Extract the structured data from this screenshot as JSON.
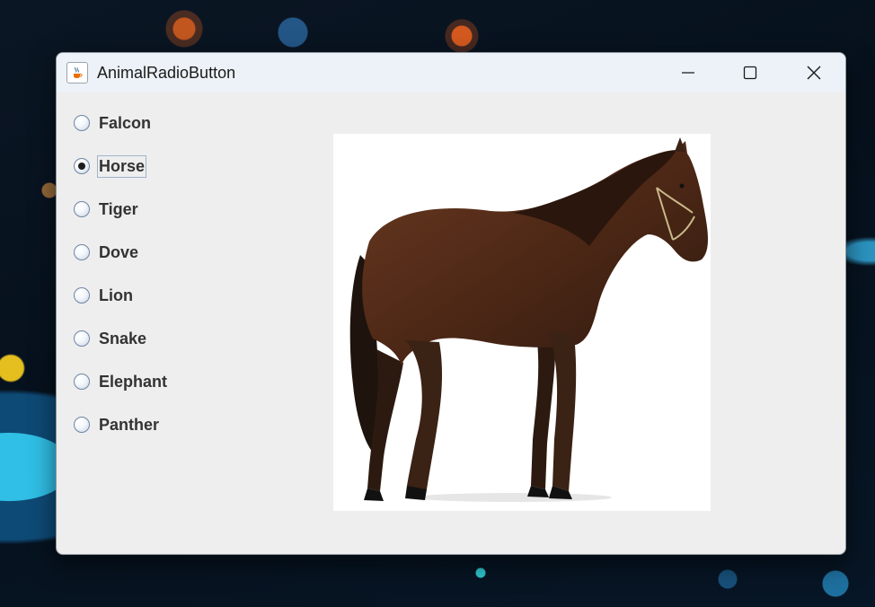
{
  "window": {
    "title": "AnimalRadioButton"
  },
  "radio_group": {
    "options": [
      {
        "label": "Falcon",
        "selected": false
      },
      {
        "label": "Horse",
        "selected": true
      },
      {
        "label": "Tiger",
        "selected": false
      },
      {
        "label": "Dove",
        "selected": false
      },
      {
        "label": "Lion",
        "selected": false
      },
      {
        "label": "Snake",
        "selected": false
      },
      {
        "label": "Elephant",
        "selected": false
      },
      {
        "label": "Panther",
        "selected": false
      }
    ]
  },
  "image": {
    "subject": "horse"
  },
  "icons": {
    "app": "java-coffee-cup-icon",
    "minimize": "minimize-icon",
    "maximize": "maximize-icon",
    "close": "close-icon"
  },
  "colors": {
    "window_bg": "#eeeeee",
    "titlebar_bg": "#ecf2f7",
    "label_text": "#333333",
    "radio_border": "#6f86a3"
  }
}
